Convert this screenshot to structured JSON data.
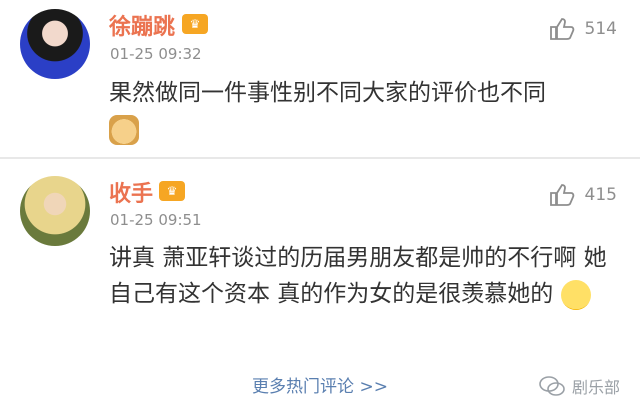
{
  "comments": [
    {
      "username": "徐蹦跳",
      "badge": "♛",
      "time": "01-25 09:32",
      "likes": "514",
      "text": "果然做同一件事性别不同大家的评价也不同",
      "emoji": "doge-icon"
    },
    {
      "username": "收手",
      "badge": "♛",
      "time": "01-25 09:51",
      "likes": "415",
      "text": "讲真 萧亚轩谈过的历届男朋友都是帅的不行啊 她自己有这个资本 真的作为女的是很羡慕她的",
      "emoji": "smile-icon"
    }
  ],
  "footer": {
    "more_label": "更多热门评论 >>",
    "watermark": "剧乐部"
  },
  "colors": {
    "username": "#eb7350",
    "time": "#8e8e8e",
    "link": "#5a7fb0"
  }
}
